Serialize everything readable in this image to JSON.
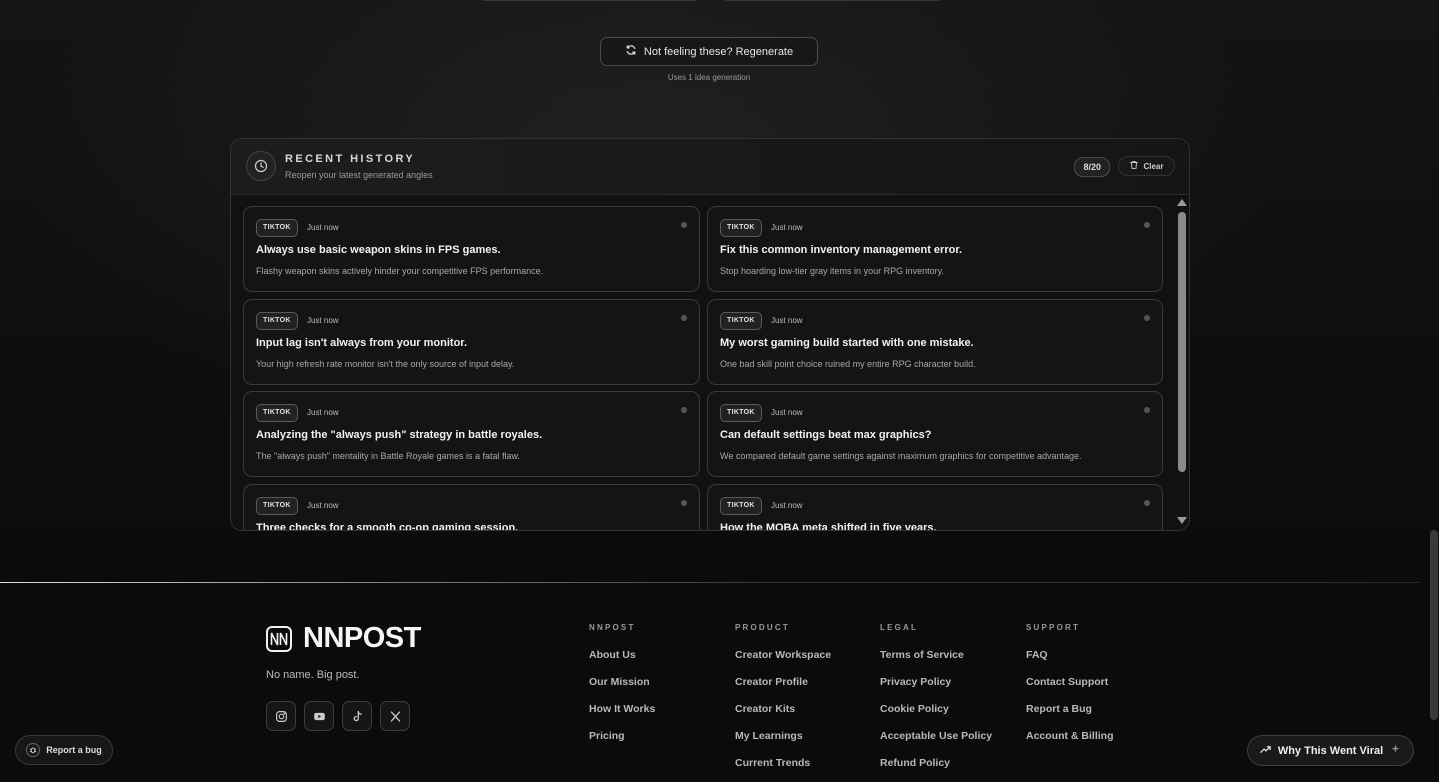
{
  "regenerate": {
    "label": "Not feeling these? Regenerate",
    "note": "Uses 1 idea generation"
  },
  "history": {
    "title": "RECENT HISTORY",
    "subtitle": "Reopen your latest generated angles",
    "count": "8/20",
    "clear_label": "Clear",
    "items": [
      {
        "platform": "TIKTOK",
        "time": "Just now",
        "title": "Always use basic weapon skins in FPS games.",
        "desc": "Flashy weapon skins actively hinder your competitive FPS performance."
      },
      {
        "platform": "TIKTOK",
        "time": "Just now",
        "title": "Fix this common inventory management error.",
        "desc": "Stop hoarding low-tier gray items in your RPG inventory."
      },
      {
        "platform": "TIKTOK",
        "time": "Just now",
        "title": "Input lag isn't always from your monitor.",
        "desc": "Your high refresh rate monitor isn't the only source of input delay."
      },
      {
        "platform": "TIKTOK",
        "time": "Just now",
        "title": "My worst gaming build started with one mistake.",
        "desc": "One bad skill point choice ruined my entire RPG character build."
      },
      {
        "platform": "TIKTOK",
        "time": "Just now",
        "title": "Analyzing the \"always push\" strategy in battle royales.",
        "desc": "The \"always push\" mentality in Battle Royale games is a fatal flaw."
      },
      {
        "platform": "TIKTOK",
        "time": "Just now",
        "title": "Can default settings beat max graphics?",
        "desc": "We compared default game settings against maximum graphics for competitive advantage."
      },
      {
        "platform": "TIKTOK",
        "time": "Just now",
        "title": "Three checks for a smooth co-op gaming session.",
        "desc": ""
      },
      {
        "platform": "TIKTOK",
        "time": "Just now",
        "title": "How the MOBA meta shifted in five years.",
        "desc": ""
      }
    ]
  },
  "footer": {
    "brand": "NNPOST",
    "tagline": "No name. Big post.",
    "socials": [
      "instagram-icon",
      "youtube-icon",
      "tiktok-icon",
      "x-icon"
    ],
    "columns": [
      {
        "heading": "NNPOST",
        "links": [
          "About Us",
          "Our Mission",
          "How It Works",
          "Pricing"
        ]
      },
      {
        "heading": "PRODUCT",
        "links": [
          "Creator Workspace",
          "Creator Profile",
          "Creator Kits",
          "My Learnings",
          "Current Trends"
        ]
      },
      {
        "heading": "LEGAL",
        "links": [
          "Terms of Service",
          "Privacy Policy",
          "Cookie Policy",
          "Acceptable Use Policy",
          "Refund Policy"
        ]
      },
      {
        "heading": "SUPPORT",
        "links": [
          "FAQ",
          "Contact Support",
          "Report a Bug",
          "Account & Billing"
        ]
      }
    ]
  },
  "floating": {
    "report_bug": "Report a bug",
    "why_viral": "Why This Went Viral"
  }
}
